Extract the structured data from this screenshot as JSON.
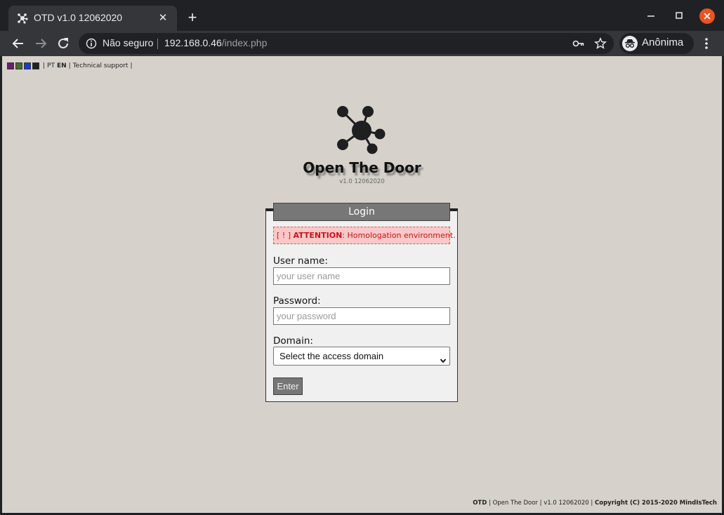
{
  "browser": {
    "tab_title": "OTD v1.0 12062020",
    "tab_close": "✕",
    "new_tab": "+",
    "security_text": "Não seguro",
    "url_host": "192.168.0.46",
    "url_path": "/index.php",
    "profile_label": "Anônima"
  },
  "page": {
    "topbar": {
      "theme_colors": [
        "#6b1f6b",
        "#4a6b2a",
        "#1c3ad1",
        "#222222"
      ],
      "sep": "|",
      "lang_pt": "PT",
      "lang_en": "EN",
      "support": "Technical support",
      "sep_end": "|"
    },
    "app": {
      "title": "Open The Door",
      "version": "v1.0 12062020"
    },
    "login": {
      "header": "Login",
      "alert_prefix": "[ ! ]",
      "alert_strong": "ATTENTION",
      "alert_text": ": Homologation environment.",
      "username_label": "User name:",
      "username_placeholder": "your user name",
      "password_label": "Password:",
      "password_placeholder": "your password",
      "domain_label": "Domain:",
      "domain_selected": "Select the access domain",
      "enter_label": "Enter"
    },
    "footer": {
      "app_short": "OTD",
      "sep1": " | ",
      "app_name": "Open The Door",
      "sep2": " | ",
      "version": "v1.0 12062020",
      "sep3": " | ",
      "copyright": "Copyright (C) 2015-2020 MindIsTech"
    }
  },
  "colors": {
    "page_bg": "#d6d2cb",
    "alert_text": "#c0161e",
    "alert_bg": "#f9c8c8",
    "header_bg": "#777777"
  }
}
